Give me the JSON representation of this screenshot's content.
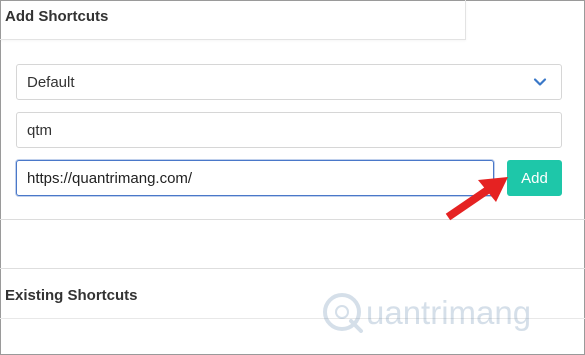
{
  "add_section": {
    "title": "Add Shortcuts"
  },
  "form": {
    "category_select": {
      "selected": "Default",
      "icon": "chevron-down-icon"
    },
    "name_input": {
      "value": "qtm"
    },
    "url_input": {
      "value": "https://quantrimang.com/"
    },
    "add_button_label": "Add"
  },
  "existing_section": {
    "title": "Existing Shortcuts"
  },
  "watermark": {
    "text": "uantrimang"
  },
  "colors": {
    "add_button": "#1ec7a9",
    "focus_border": "#4a78c9",
    "arrow": "#e52222",
    "chevron": "#3a78c8"
  }
}
